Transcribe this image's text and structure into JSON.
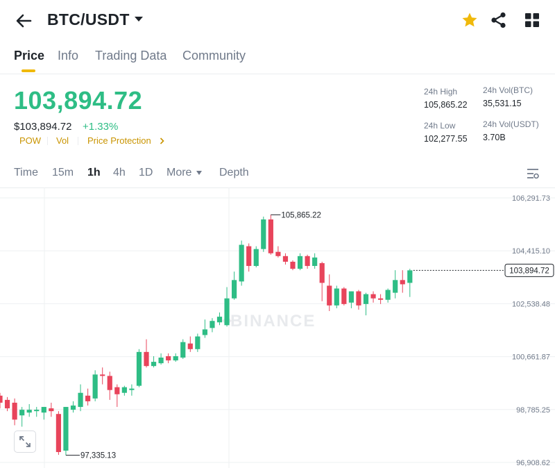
{
  "header": {
    "pair": "BTC/USDT",
    "icons": {
      "back": "arrow-left-icon",
      "favorite": "star-icon",
      "share": "share-icon",
      "grid": "grid-icon"
    },
    "favorite_color": "#f0b90b"
  },
  "tabs": [
    {
      "label": "Price",
      "active": true
    },
    {
      "label": "Info",
      "active": false
    },
    {
      "label": "Trading Data",
      "active": false
    },
    {
      "label": "Community",
      "active": false
    }
  ],
  "price": {
    "last": "103,894.72",
    "usd": "$103,894.72",
    "change": "+1.33%",
    "tags": [
      "POW",
      "Vol",
      "Price Protection"
    ]
  },
  "stats": {
    "high_label": "24h High",
    "high": "105,865.22",
    "low_label": "24h Low",
    "low": "102,277.55",
    "vol_btc_label": "24h Vol(BTC)",
    "vol_btc": "35,531.15",
    "vol_usdt_label": "24h Vol(USDT)",
    "vol_usdt": "3.70B"
  },
  "timeframes": {
    "items": [
      {
        "label": "Time",
        "active": false
      },
      {
        "label": "15m",
        "active": false
      },
      {
        "label": "1h",
        "active": true
      },
      {
        "label": "4h",
        "active": false
      },
      {
        "label": "1D",
        "active": false
      },
      {
        "label": "More",
        "active": false
      },
      {
        "label": "Depth",
        "active": false
      }
    ],
    "settings_icon": "chart-settings-icon"
  },
  "chart_data": {
    "type": "candlestick",
    "y_ticks": [
      106291.73,
      104415.1,
      102538.48,
      100661.87,
      98785.25,
      96908.62
    ],
    "y_tick_labels": [
      "106,291.73",
      "104,415.10",
      "102,538.48",
      "100,661.87",
      "98,785.25",
      "96,908.62"
    ],
    "last_price_label": "103,894.72",
    "last_price": 103894.72,
    "max_annotation": "105,865.22",
    "max_value": 105865.22,
    "min_annotation": "97,335.13",
    "min_value": 97335.13,
    "watermark": "BINANCE",
    "up_color": "#2ebd85",
    "down_color": "#e8445b",
    "candles": [
      {
        "o": 99450,
        "h": 99550,
        "c": 99200,
        "l": 99000
      },
      {
        "o": 99300,
        "h": 99400,
        "c": 99000,
        "l": 98900
      },
      {
        "o": 99200,
        "h": 99350,
        "c": 98600,
        "l": 98400
      },
      {
        "o": 98750,
        "h": 99050,
        "c": 98950,
        "l": 98350
      },
      {
        "o": 98850,
        "h": 99150,
        "c": 98950,
        "l": 98700
      },
      {
        "o": 98900,
        "h": 99050,
        "c": 98950,
        "l": 98700
      },
      {
        "o": 98850,
        "h": 99050,
        "c": 99050,
        "l": 98600
      },
      {
        "o": 99000,
        "h": 99200,
        "c": 98900,
        "l": 98700
      },
      {
        "o": 98800,
        "h": 98900,
        "c": 97450,
        "l": 97350
      },
      {
        "o": 97500,
        "h": 99050,
        "c": 99050,
        "l": 97335.13
      },
      {
        "o": 98950,
        "h": 99250,
        "c": 99100,
        "l": 98850
      },
      {
        "o": 99050,
        "h": 99850,
        "c": 99550,
        "l": 98900
      },
      {
        "o": 99450,
        "h": 99700,
        "c": 99250,
        "l": 99100
      },
      {
        "o": 99350,
        "h": 100350,
        "c": 100200,
        "l": 99250
      },
      {
        "o": 100200,
        "h": 100450,
        "c": 100150,
        "l": 99850
      },
      {
        "o": 100150,
        "h": 100300,
        "c": 99650,
        "l": 99300
      },
      {
        "o": 99750,
        "h": 99850,
        "c": 99500,
        "l": 99050
      },
      {
        "o": 99550,
        "h": 99800,
        "c": 99750,
        "l": 99450
      },
      {
        "o": 99650,
        "h": 99850,
        "c": 99700,
        "l": 99450
      },
      {
        "o": 99800,
        "h": 101100,
        "c": 101000,
        "l": 99750
      },
      {
        "o": 101000,
        "h": 101450,
        "c": 100500,
        "l": 100450
      },
      {
        "o": 100500,
        "h": 100850,
        "c": 100650,
        "l": 100450
      },
      {
        "o": 100600,
        "h": 100950,
        "c": 100800,
        "l": 100550
      },
      {
        "o": 100850,
        "h": 100950,
        "c": 100700,
        "l": 100600
      },
      {
        "o": 100700,
        "h": 100950,
        "c": 100850,
        "l": 100650
      },
      {
        "o": 100800,
        "h": 101450,
        "c": 101350,
        "l": 100750
      },
      {
        "o": 101300,
        "h": 101550,
        "c": 101100,
        "l": 101000
      },
      {
        "o": 101100,
        "h": 101650,
        "c": 101550,
        "l": 101000
      },
      {
        "o": 101600,
        "h": 102150,
        "c": 101800,
        "l": 101500
      },
      {
        "o": 101850,
        "h": 102200,
        "c": 102100,
        "l": 101700
      },
      {
        "o": 102050,
        "h": 102400,
        "c": 102250,
        "l": 101950
      },
      {
        "o": 101950,
        "h": 103300,
        "c": 102900,
        "l": 101900
      },
      {
        "o": 102900,
        "h": 103850,
        "c": 103550,
        "l": 102850
      },
      {
        "o": 103500,
        "h": 104950,
        "c": 104800,
        "l": 103350
      },
      {
        "o": 104750,
        "h": 104850,
        "c": 104050,
        "l": 103850
      },
      {
        "o": 104050,
        "h": 104750,
        "c": 104650,
        "l": 104000
      },
      {
        "o": 104650,
        "h": 105800,
        "c": 105700,
        "l": 104550
      },
      {
        "o": 105700,
        "h": 105865.22,
        "c": 104500,
        "l": 104450
      },
      {
        "o": 104550,
        "h": 104750,
        "c": 104400,
        "l": 104350
      },
      {
        "o": 104400,
        "h": 104500,
        "c": 104200,
        "l": 104100
      },
      {
        "o": 104200,
        "h": 104250,
        "c": 103950,
        "l": 103900
      },
      {
        "o": 103950,
        "h": 104500,
        "c": 104400,
        "l": 103900
      },
      {
        "o": 104400,
        "h": 104450,
        "c": 104050,
        "l": 103950
      },
      {
        "o": 104050,
        "h": 104500,
        "c": 104350,
        "l": 103950
      },
      {
        "o": 104150,
        "h": 104200,
        "c": 103450,
        "l": 102800
      },
      {
        "o": 103350,
        "h": 103750,
        "c": 102650,
        "l": 102450
      },
      {
        "o": 102650,
        "h": 103350,
        "c": 103250,
        "l": 102550
      },
      {
        "o": 103250,
        "h": 103300,
        "c": 102700,
        "l": 102650
      },
      {
        "o": 102750,
        "h": 103150,
        "c": 103150,
        "l": 102550
      },
      {
        "o": 103150,
        "h": 103200,
        "c": 102650,
        "l": 102500
      },
      {
        "o": 102700,
        "h": 103100,
        "c": 103050,
        "l": 102300
      },
      {
        "o": 103050,
        "h": 103150,
        "c": 102900,
        "l": 102750
      },
      {
        "o": 102900,
        "h": 103050,
        "c": 102850,
        "l": 102700
      },
      {
        "o": 102850,
        "h": 103250,
        "c": 103200,
        "l": 102750
      },
      {
        "o": 103100,
        "h": 103900,
        "c": 103550,
        "l": 102900
      },
      {
        "o": 103550,
        "h": 103900,
        "c": 103400,
        "l": 103100
      },
      {
        "o": 103450,
        "h": 103950,
        "c": 103894.72,
        "l": 102950
      }
    ]
  }
}
